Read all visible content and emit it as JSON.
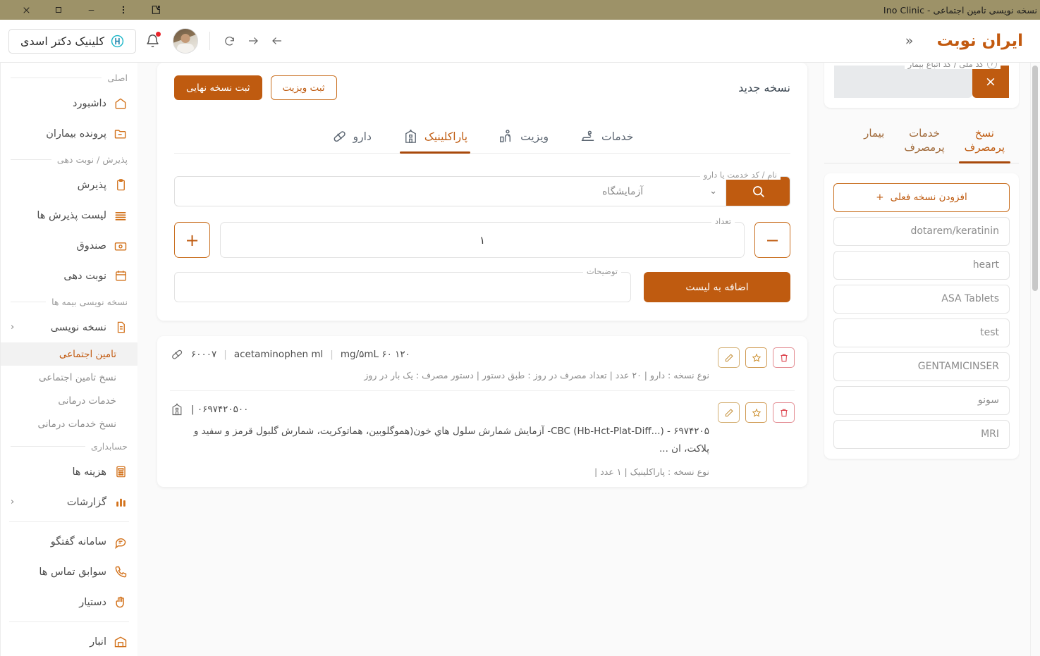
{
  "window": {
    "title": "نسخه نویسی تامین اجتماعی - Ino Clinic",
    "controls": {
      "extension": "extension-icon",
      "menu": "kebab-menu-icon",
      "minimize": "minimize-icon",
      "maximize": "maximize-icon",
      "close": "close-icon"
    }
  },
  "header": {
    "brand": "ایران نوبت",
    "collapse": "«",
    "clinic_name": "کلینیک دکتر اسدی",
    "nav": {
      "back": "back-icon",
      "forward": "forward-icon",
      "reload": "reload-icon"
    }
  },
  "sidebar": {
    "groups": [
      {
        "label": "اصلی",
        "items": [
          {
            "label": "داشبورد",
            "icon": "home-icon",
            "chevron": ""
          },
          {
            "label": "پرونده بیماران",
            "icon": "folder-icon",
            "chevron": ""
          }
        ]
      },
      {
        "label": "پذیرش / نوبت دهی",
        "items": [
          {
            "label": "پذیرش",
            "icon": "clipboard-icon",
            "chevron": ""
          },
          {
            "label": "لیست پذیرش ها",
            "icon": "list-icon",
            "chevron": ""
          },
          {
            "label": "صندوق",
            "icon": "cashbox-icon",
            "chevron": ""
          },
          {
            "label": "نوبت دهی",
            "icon": "calendar-icon",
            "chevron": ""
          }
        ]
      },
      {
        "label": "نسخه نویسی بیمه ها",
        "items": [
          {
            "label": "نسخه نویسی",
            "icon": "document-icon",
            "chevron": "‹"
          }
        ],
        "subitems": [
          {
            "label": "تامین اجتماعی",
            "active": true
          },
          {
            "label": "نسخ تامین اجتماعی",
            "active": false
          },
          {
            "label": "خدمات درمانی",
            "active": false
          },
          {
            "label": "نسخ خدمات درمانی",
            "active": false
          }
        ]
      },
      {
        "label": "حسابداری",
        "items": [
          {
            "label": "هزینه ها",
            "icon": "calculator-icon",
            "chevron": ""
          },
          {
            "label": "گزارشات",
            "icon": "chart-icon",
            "chevron": "‹"
          }
        ]
      },
      {
        "label": "",
        "items": [
          {
            "label": "سامانه گفتگو",
            "icon": "chat-icon",
            "chevron": ""
          },
          {
            "label": "سوابق تماس ها",
            "icon": "phone-icon",
            "chevron": ""
          },
          {
            "label": "دستیار",
            "icon": "hand-icon",
            "chevron": ""
          }
        ]
      },
      {
        "label": "",
        "items": [
          {
            "label": "انبار",
            "icon": "warehouse-icon",
            "chevron": ""
          }
        ]
      }
    ]
  },
  "info_panel": {
    "national_id_legend": "کد ملی / کد اتباع بیمار",
    "national_id_value": "",
    "clear_label": "×",
    "tabs": [
      {
        "label": "بیمار",
        "active": false
      },
      {
        "label": "خدمات\nپرمصرف",
        "active": false
      },
      {
        "label": "نسخ\nپرمصرف",
        "active": true
      }
    ],
    "add_current_label": "افزودن نسخه فعلی",
    "add_plus": "+",
    "favorites": [
      "dotarem/keratinin",
      "heart",
      "ASA Tablets",
      "test",
      "GENTAMICINSER",
      "سونو",
      "MRI"
    ]
  },
  "content": {
    "card_title": "نسخه جدید",
    "btn_final": "ثبت نسخه نهایی",
    "btn_visit": "ثبت ویزیت",
    "tabs": [
      {
        "label": "دارو",
        "icon": "pill-icon",
        "active": false
      },
      {
        "label": "پاراکلینیک",
        "icon": "hospital-icon",
        "active": true
      },
      {
        "label": "ویزیت",
        "icon": "reception-icon",
        "active": false
      },
      {
        "label": "خدمات",
        "icon": "therapy-icon",
        "active": false
      }
    ],
    "search": {
      "legend": "نام / کد خدمت یا دارو",
      "value": "",
      "placeholder": "",
      "select_value": "آزمایشگاه",
      "chevron": "⌄",
      "search_icon": "search-icon"
    },
    "quantity": {
      "legend": "تعداد",
      "value": "۱",
      "minus": "−",
      "plus": "+"
    },
    "description": {
      "legend": "توضیحات",
      "value": "",
      "add_label": "اضافه به لیست"
    }
  },
  "prescriptions": [
    {
      "icon": "pill-icon",
      "code": "۶۰۰۰۷",
      "name": "acetaminophen ml",
      "dose": "۱۲۰ mg/۵mL ۶۰",
      "description": "",
      "meta": "نوع نسخه : دارو  |  ۲۰ عدد  |  تعداد مصرف در روز : طبق دستور  |  دستور مصرف : یک بار در روز",
      "actions": {
        "delete": "trash-icon",
        "favorite": "star-icon",
        "edit": "pencil-icon"
      }
    },
    {
      "icon": "hospital-icon",
      "code": "۰۶۹۷۴۲۰۵۰۰ |",
      "name": "",
      "dose": "",
      "description": "۶۹۷۴۲۰۵ - (...CBC (Hb-Hct-Plat-Diff- آزمایش شمارش سلول هاي خون(هموگلوبین، هماتوکریت، شمارش گلبول قرمز و سفید و پلاکت، ان ...",
      "meta": "نوع نسخه : پاراکلینیک  |  ۱ عدد |",
      "actions": {
        "delete": "trash-icon",
        "favorite": "star-icon",
        "edit": "pencil-icon"
      }
    }
  ],
  "colors": {
    "accent": "#bf5b10",
    "accent_dark": "#a8490b",
    "titlebar": "#9d9268",
    "danger": "#dd4650",
    "muted": "#8c8c8c"
  }
}
